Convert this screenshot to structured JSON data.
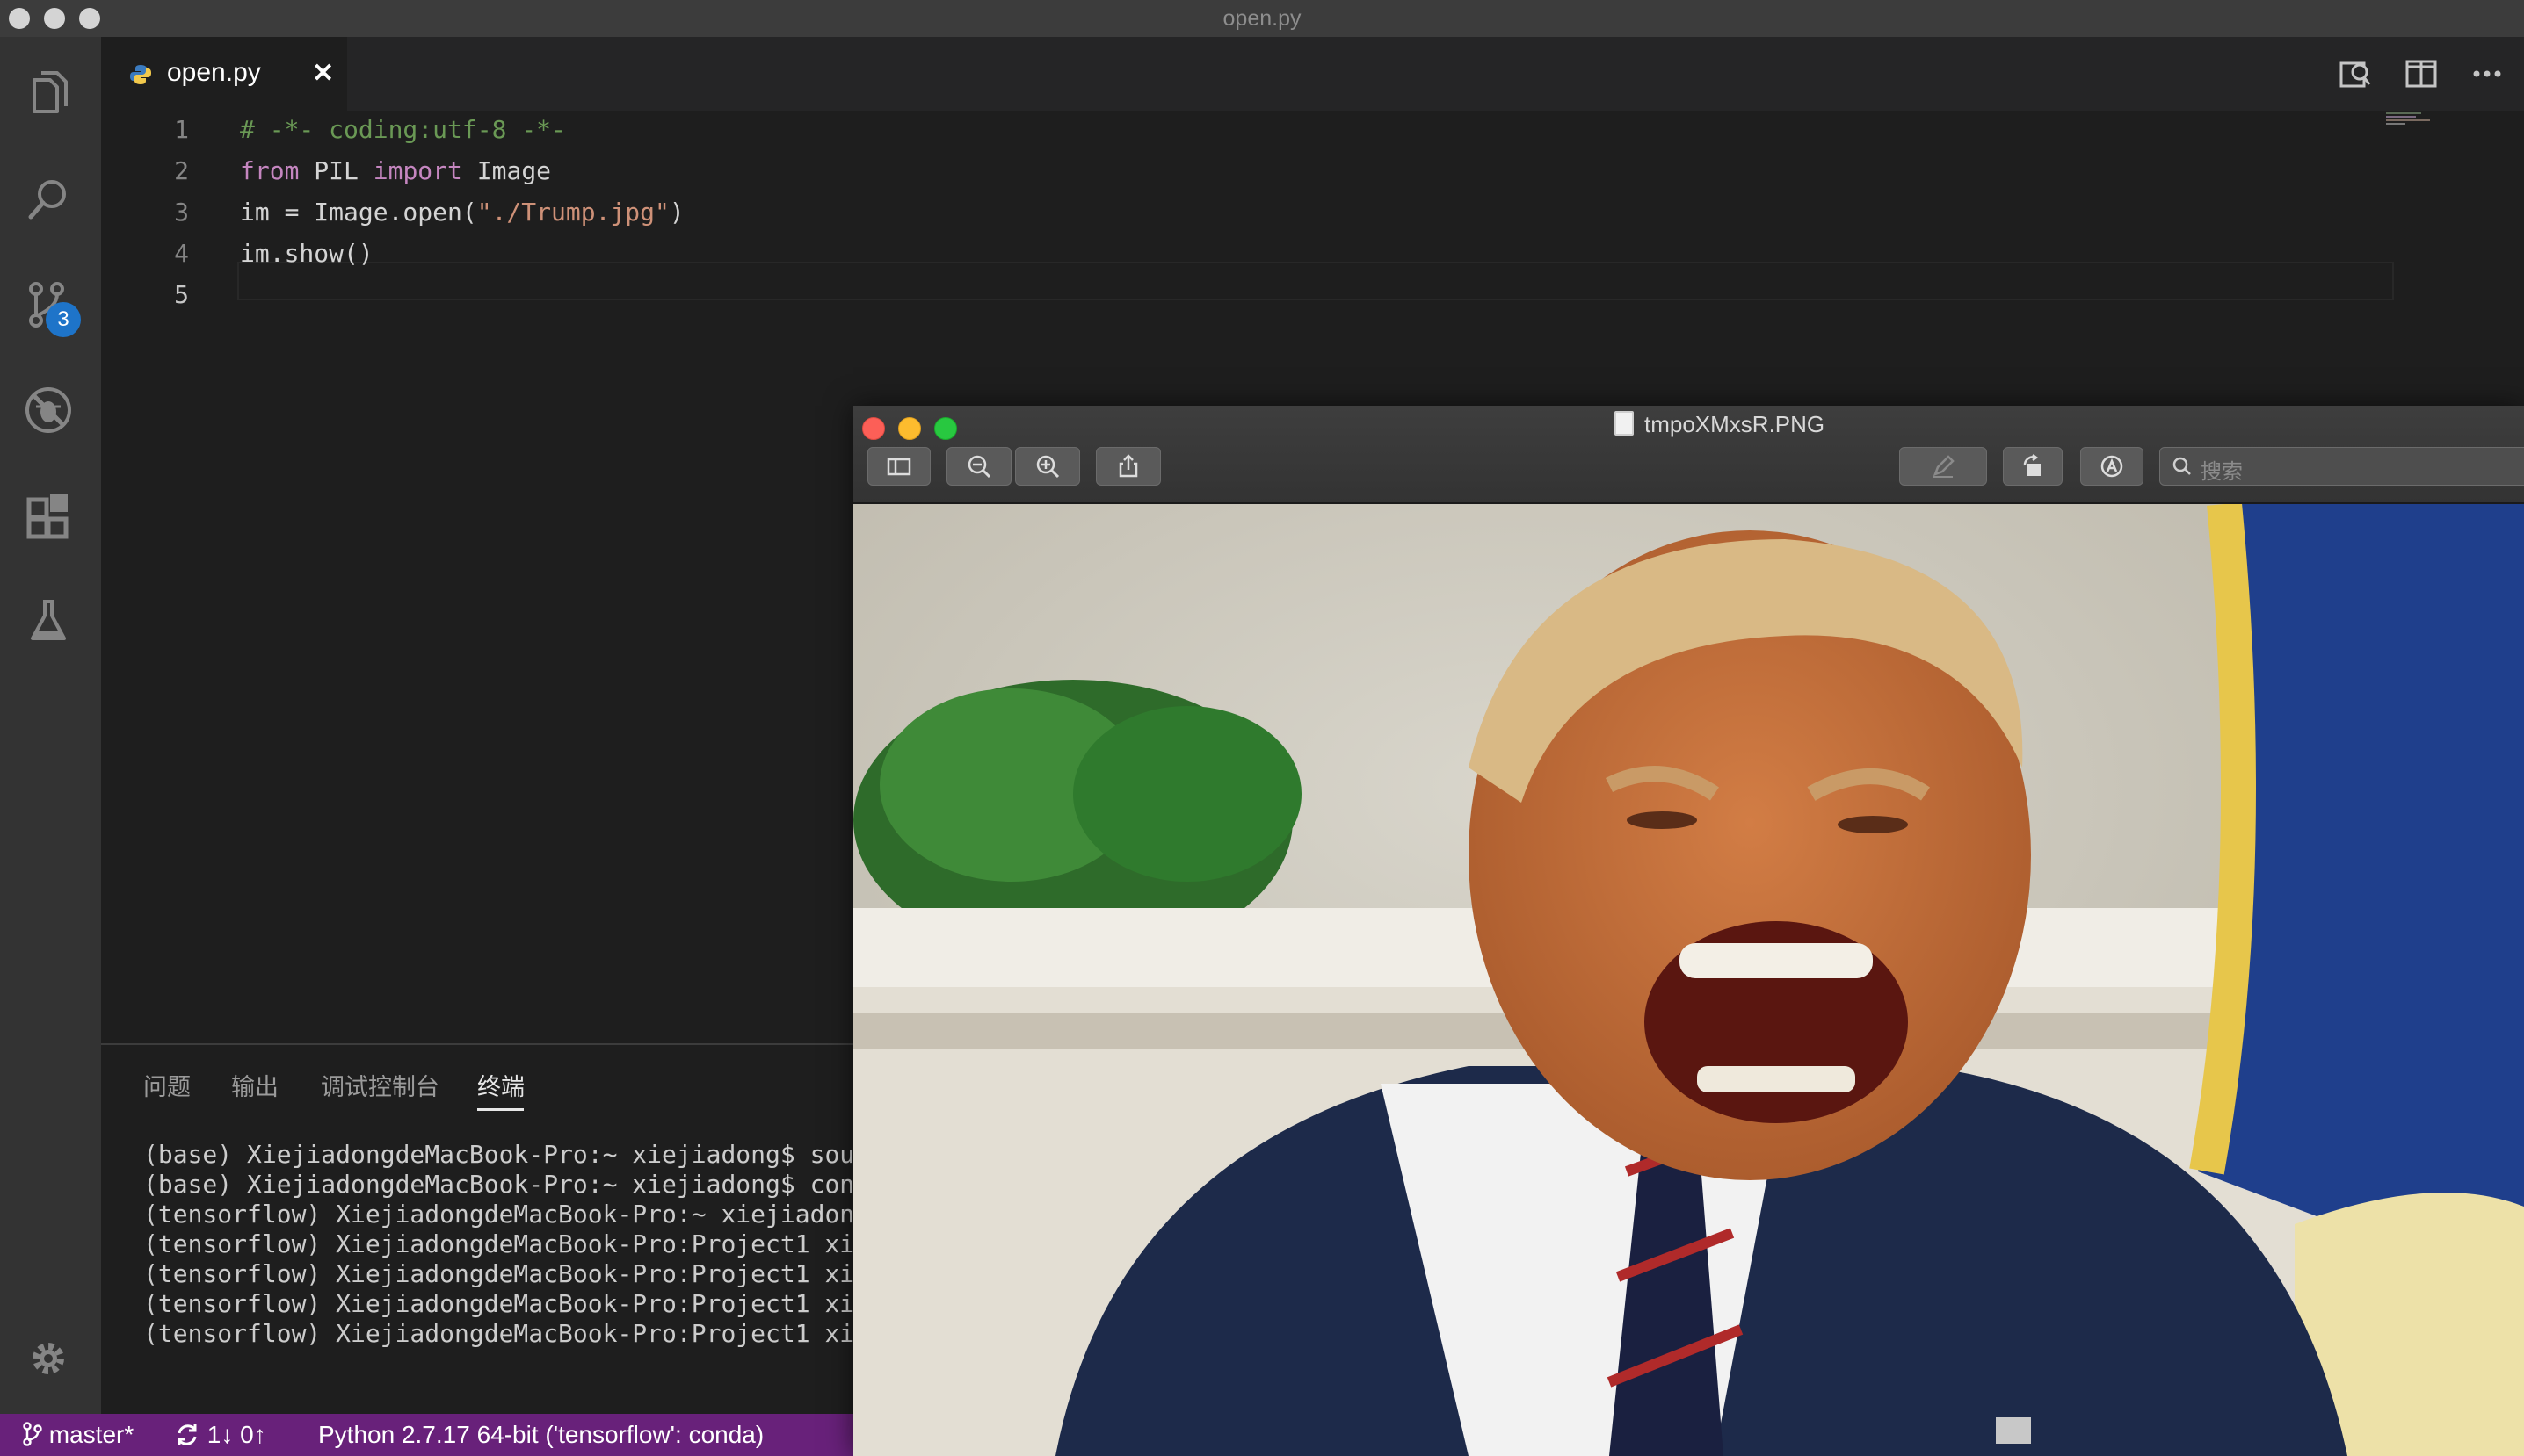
{
  "window": {
    "title": "open.py"
  },
  "activity_bar": {
    "scm_badge": "3"
  },
  "editor": {
    "tab_label": "open.py",
    "tab_close": "✕",
    "lines": [
      {
        "num": "1",
        "segments": [
          {
            "t": "# -*- coding:utf-8 -*-",
            "c": "comment"
          }
        ]
      },
      {
        "num": "2",
        "segments": [
          {
            "t": "from",
            "c": "kw"
          },
          {
            "t": " PIL ",
            "c": "plain"
          },
          {
            "t": "import",
            "c": "kw"
          },
          {
            "t": " Image",
            "c": "plain"
          }
        ]
      },
      {
        "num": "3",
        "segments": [
          {
            "t": "im = Image.open(",
            "c": "plain"
          },
          {
            "t": "\"./Trump.jpg\"",
            "c": "str"
          },
          {
            "t": ")",
            "c": "plain"
          }
        ]
      },
      {
        "num": "4",
        "segments": [
          {
            "t": "im.show()",
            "c": "plain"
          }
        ]
      },
      {
        "num": "5",
        "segments": []
      }
    ]
  },
  "panel": {
    "tabs": [
      "问题",
      "输出",
      "调试控制台",
      "终端"
    ],
    "active_tab": "终端",
    "terminal_lines": [
      "(base) XiejiadongdeMacBook-Pro:~ xiejiadong$ sou",
      "(base) XiejiadongdeMacBook-Pro:~ xiejiadong$ con",
      "(tensorflow) XiejiadongdeMacBook-Pro:~ xiejiadon",
      "(tensorflow) XiejiadongdeMacBook-Pro:Project1 xi",
      "(tensorflow) XiejiadongdeMacBook-Pro:Project1 xi",
      "(tensorflow) XiejiadongdeMacBook-Pro:Project1 xi",
      "(tensorflow) XiejiadongdeMacBook-Pro:Project1 xi"
    ]
  },
  "status_bar": {
    "branch": "master*",
    "sync": "1↓ 0↑",
    "interpreter": "Python 2.7.17 64-bit ('tensorflow': conda)"
  },
  "preview": {
    "title": "tmpoXMxsR.PNG",
    "search_placeholder": "搜索"
  },
  "colors": {
    "status_bar": "#68217a",
    "activity_bar": "#333333",
    "editor_bg": "#1e1e1e",
    "badge": "#1e74c9",
    "keyword": "#c586c0",
    "string": "#ce9178",
    "comment": "#6a9955"
  }
}
